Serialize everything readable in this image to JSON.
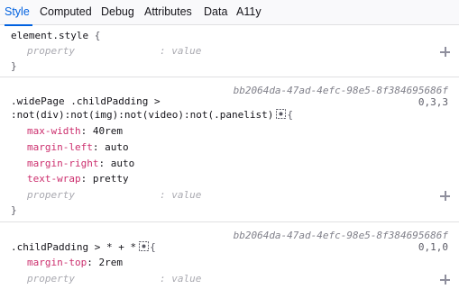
{
  "tabs": [
    {
      "label": "Style",
      "active": true
    },
    {
      "label": "Computed"
    },
    {
      "label": "Debug"
    },
    {
      "label": "Attributes"
    },
    {
      "label": "Data"
    },
    {
      "label": "A11y"
    }
  ],
  "element_style": {
    "selector": "element.style",
    "open_brace": "{",
    "close_brace": "}",
    "placeholder_property": "property",
    "placeholder_colon": ":",
    "placeholder_value": "value"
  },
  "rule1": {
    "source": "bb2064da-47ad-4efc-98e5-8f384695686f",
    "specificity": "0,3,3",
    "selector_line1": ".widePage .childPadding >",
    "selector_line2": ":not(div):not(img):not(video):not(.panelist)",
    "open_brace": "{",
    "close_brace": "}",
    "declarations": [
      {
        "name": "max-width",
        "colon": ":",
        "value": "40rem"
      },
      {
        "name": "margin-left",
        "colon": ":",
        "value": "auto"
      },
      {
        "name": "margin-right",
        "colon": ":",
        "value": "auto"
      },
      {
        "name": "text-wrap",
        "colon": ":",
        "value": "pretty"
      }
    ],
    "placeholder_property": "property",
    "placeholder_colon": ":",
    "placeholder_value": "value"
  },
  "rule2": {
    "source": "bb2064da-47ad-4efc-98e5-8f384695686f",
    "specificity": "0,1,0",
    "selector": ".childPadding > * + *",
    "open_brace": "{",
    "declarations": [
      {
        "name": "margin-top",
        "colon": ":",
        "value": "2rem"
      }
    ],
    "placeholder_property": "property",
    "placeholder_colon": ":",
    "placeholder_value": "value"
  }
}
